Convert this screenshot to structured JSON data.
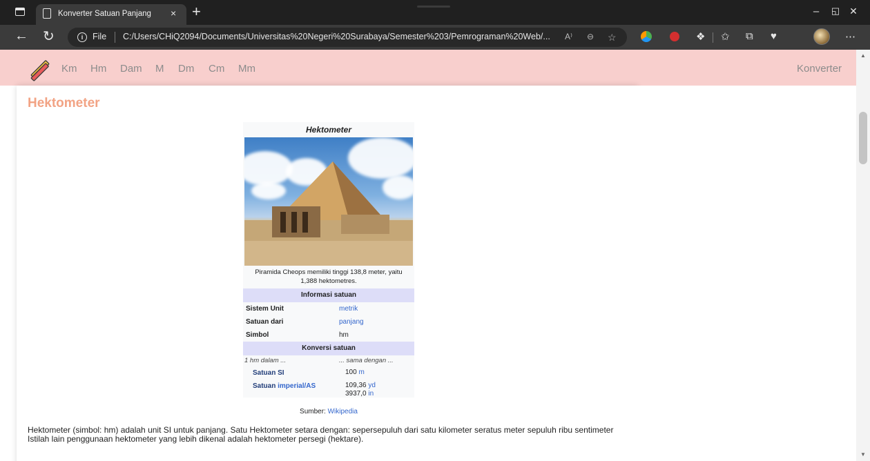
{
  "browser": {
    "tab_title": "Konverter Satuan Panjang",
    "tab_close": "×",
    "new_tab": "+",
    "address_file": "File",
    "address_url": "C:/Users/CHiQ2094/Documents/Universitas%20Negeri%20Surabaya/Semester%203/Pemrograman%20Web/...",
    "window": {
      "minimize": "–",
      "restore": "◱",
      "close": "✕"
    },
    "icons": [
      "sidebar-window-icon",
      "page-icon",
      "back-arrow-icon",
      "reload-icon",
      "info-icon",
      "read-aloud-icon",
      "zoom-out-icon",
      "favorite-add-icon",
      "extension-icon",
      "ublock-icon",
      "extensions-icon",
      "favorites-icon",
      "collections-icon",
      "health-icon",
      "profile-avatar",
      "more-menu-icon"
    ]
  },
  "nav": {
    "links": [
      "Km",
      "Hm",
      "Dam",
      "M",
      "Dm",
      "Cm",
      "Mm"
    ],
    "right": "Konverter"
  },
  "page": {
    "heading": "Hektometer",
    "infobox": {
      "title": "Hektometer",
      "caption": "Piramida Cheops memiliki tinggi 138,8 meter, yaitu 1,388 hektometres.",
      "section_info": "Informasi satuan",
      "rows": [
        {
          "key": "Sistem Unit",
          "value": "metrik"
        },
        {
          "key": "Satuan dari",
          "value": "panjang"
        },
        {
          "key": "Simbol",
          "value": "hm"
        }
      ],
      "section_conv": "Konversi satuan",
      "conv_head_left": "1 hm dalam ...",
      "conv_head_right": "... sama dengan ...",
      "conv_si_key": "Satuan SI",
      "conv_si_num": "100",
      "conv_si_unit": "m",
      "conv_imp_key_prefix": "Satuan",
      "conv_imp_key_link": "imperial/AS",
      "conv_imp_num1": "109,36",
      "conv_imp_unit1": "yd",
      "conv_imp_num2": "3937,0",
      "conv_imp_unit2": "in"
    },
    "source_label": "Sumber:",
    "source_link": "Wikipedia",
    "paragraph": "Hektometer (simbol: hm) adalah unit SI untuk panjang. Satu Hektometer setara dengan: sepersepuluh dari satu kilometer seratus meter sepuluh ribu sentimeter Istilah lain penggunaan hektometer yang lebih dikenal adalah hektometer persegi (hektare)."
  }
}
